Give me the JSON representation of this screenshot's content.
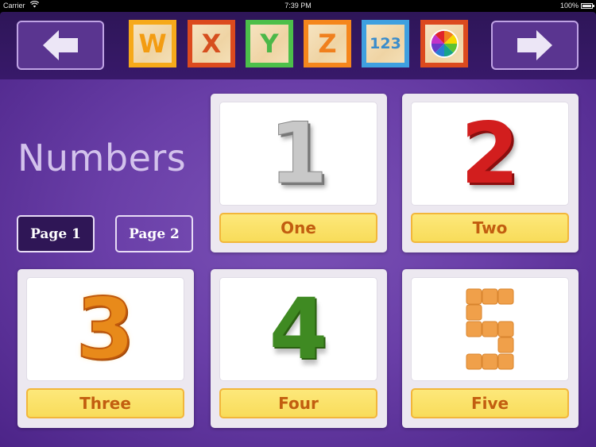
{
  "status_bar": {
    "carrier": "Carrier",
    "wifi_icon": "◔",
    "time": "7:39 PM",
    "battery_percent": "100%"
  },
  "toolbar": {
    "prev_label": "previous",
    "next_label": "next",
    "blocks": [
      {
        "label": "W",
        "border": "#f6a91a",
        "text_color": "#f39c12"
      },
      {
        "label": "X",
        "border": "#dc4a1e",
        "text_color": "#d64f1f"
      },
      {
        "label": "Y",
        "border": "#4cbf4a",
        "text_color": "#4cb848"
      },
      {
        "label": "Z",
        "border": "#f5861c",
        "text_color": "#f0801e"
      },
      {
        "label": "123",
        "border": "#3fa0e0",
        "text_color": "#3a8dcc"
      },
      {
        "label": "colors",
        "border": "#dc4a1e",
        "text_color": ""
      }
    ]
  },
  "title": "Numbers",
  "pages": {
    "page1": "Page 1",
    "page2": "Page 2",
    "active": "Page 1"
  },
  "cards": [
    {
      "digit": "1",
      "label": "One"
    },
    {
      "digit": "2",
      "label": "Two"
    },
    {
      "digit": "3",
      "label": "Three"
    },
    {
      "digit": "4",
      "label": "Four"
    },
    {
      "digit": "5",
      "label": "Five"
    }
  ]
}
